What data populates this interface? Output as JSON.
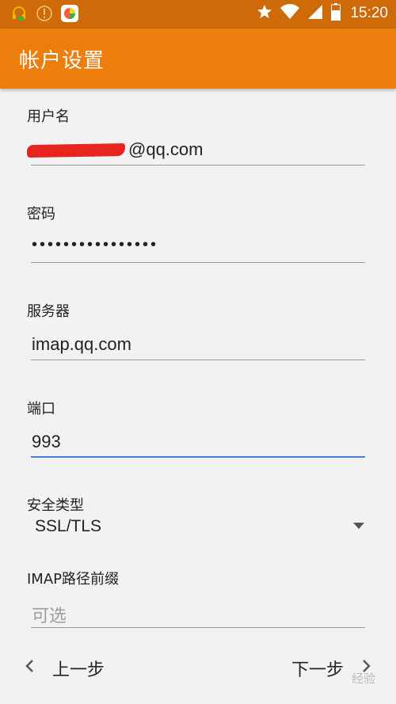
{
  "status_bar": {
    "time": "15:20",
    "icons": [
      "headset-icon",
      "alert-icon",
      "app-icon",
      "star-icon",
      "wifi-icon",
      "signal-icon",
      "battery-icon"
    ]
  },
  "appbar": {
    "title": "帐户设置"
  },
  "form": {
    "username": {
      "label": "用户名",
      "value": "@qq.com"
    },
    "password": {
      "label": "密码",
      "value": "••••••••••••••••"
    },
    "server": {
      "label": "服务器",
      "value": "imap.qq.com"
    },
    "port": {
      "label": "端口",
      "value": "993"
    },
    "security": {
      "label": "安全类型",
      "value": "SSL/TLS"
    },
    "imap_prefix": {
      "label": "IMAP路径前缀",
      "placeholder": "可选"
    }
  },
  "nav": {
    "prev_label": "上一步",
    "next_label": "下一步"
  },
  "watermark": "经验",
  "colors": {
    "statusbar": "#cf6a08",
    "appbar": "#ed7d0c",
    "focus_line": "#4a7fe0",
    "redaction": "#e8241f"
  }
}
